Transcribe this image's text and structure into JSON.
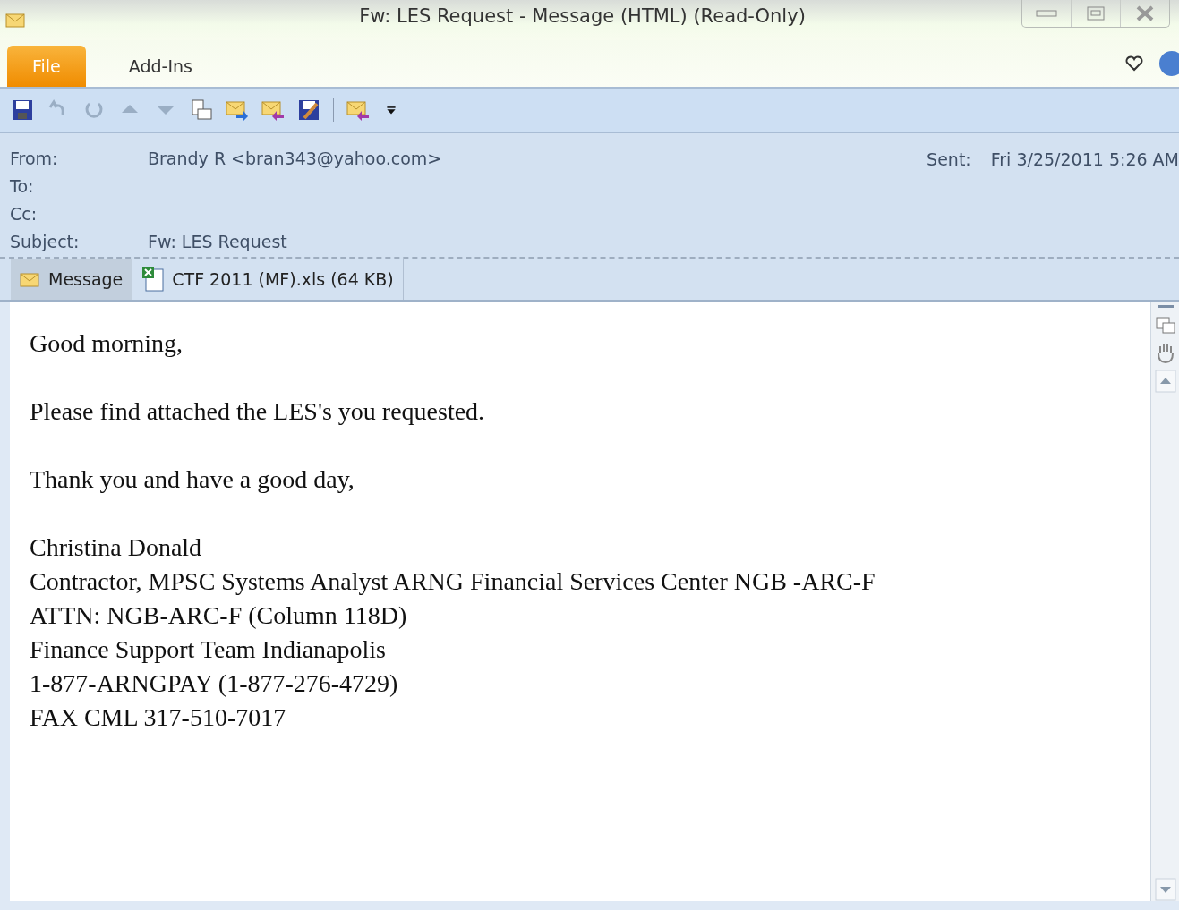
{
  "window": {
    "title": "Fw: LES Request  -  Message (HTML) (Read-Only)"
  },
  "tabs": [
    {
      "label": "File",
      "selected": true
    },
    {
      "label": "Add-Ins",
      "selected": false
    }
  ],
  "header": {
    "fields": [
      {
        "label": "From:",
        "value": "Brandy R <bran343@yahoo.com>"
      },
      {
        "label": "To:"
      },
      {
        "label": "Cc:"
      },
      {
        "label": "Subject:",
        "value": "Fw: LES Request"
      }
    ],
    "sent": {
      "label": "Sent:",
      "value": "Fri 3/25/2011 5:26 AM"
    }
  },
  "attachments": [
    {
      "kind": "message",
      "label": "Message",
      "selected": true
    },
    {
      "kind": "file",
      "label": "CTF 2011 (MF).xls (64 KB)",
      "selected": false
    }
  ],
  "body": {
    "paragraphs": [
      [
        "Good morning,"
      ],
      [
        "Please find attached the LES's you requested."
      ],
      [
        "Thank you and have a good day,"
      ],
      [
        "Christina Donald",
        "Contractor, MPSC Systems Analyst ARNG Financial Services Center NGB -ARC-F",
        "ATTN: NGB-ARC-F (Column 118D)",
        "Finance Support Team Indianapolis",
        "1-877-ARNGPAY (1-877-276-4729)",
        "FAX CML 317-510-7017"
      ]
    ]
  }
}
